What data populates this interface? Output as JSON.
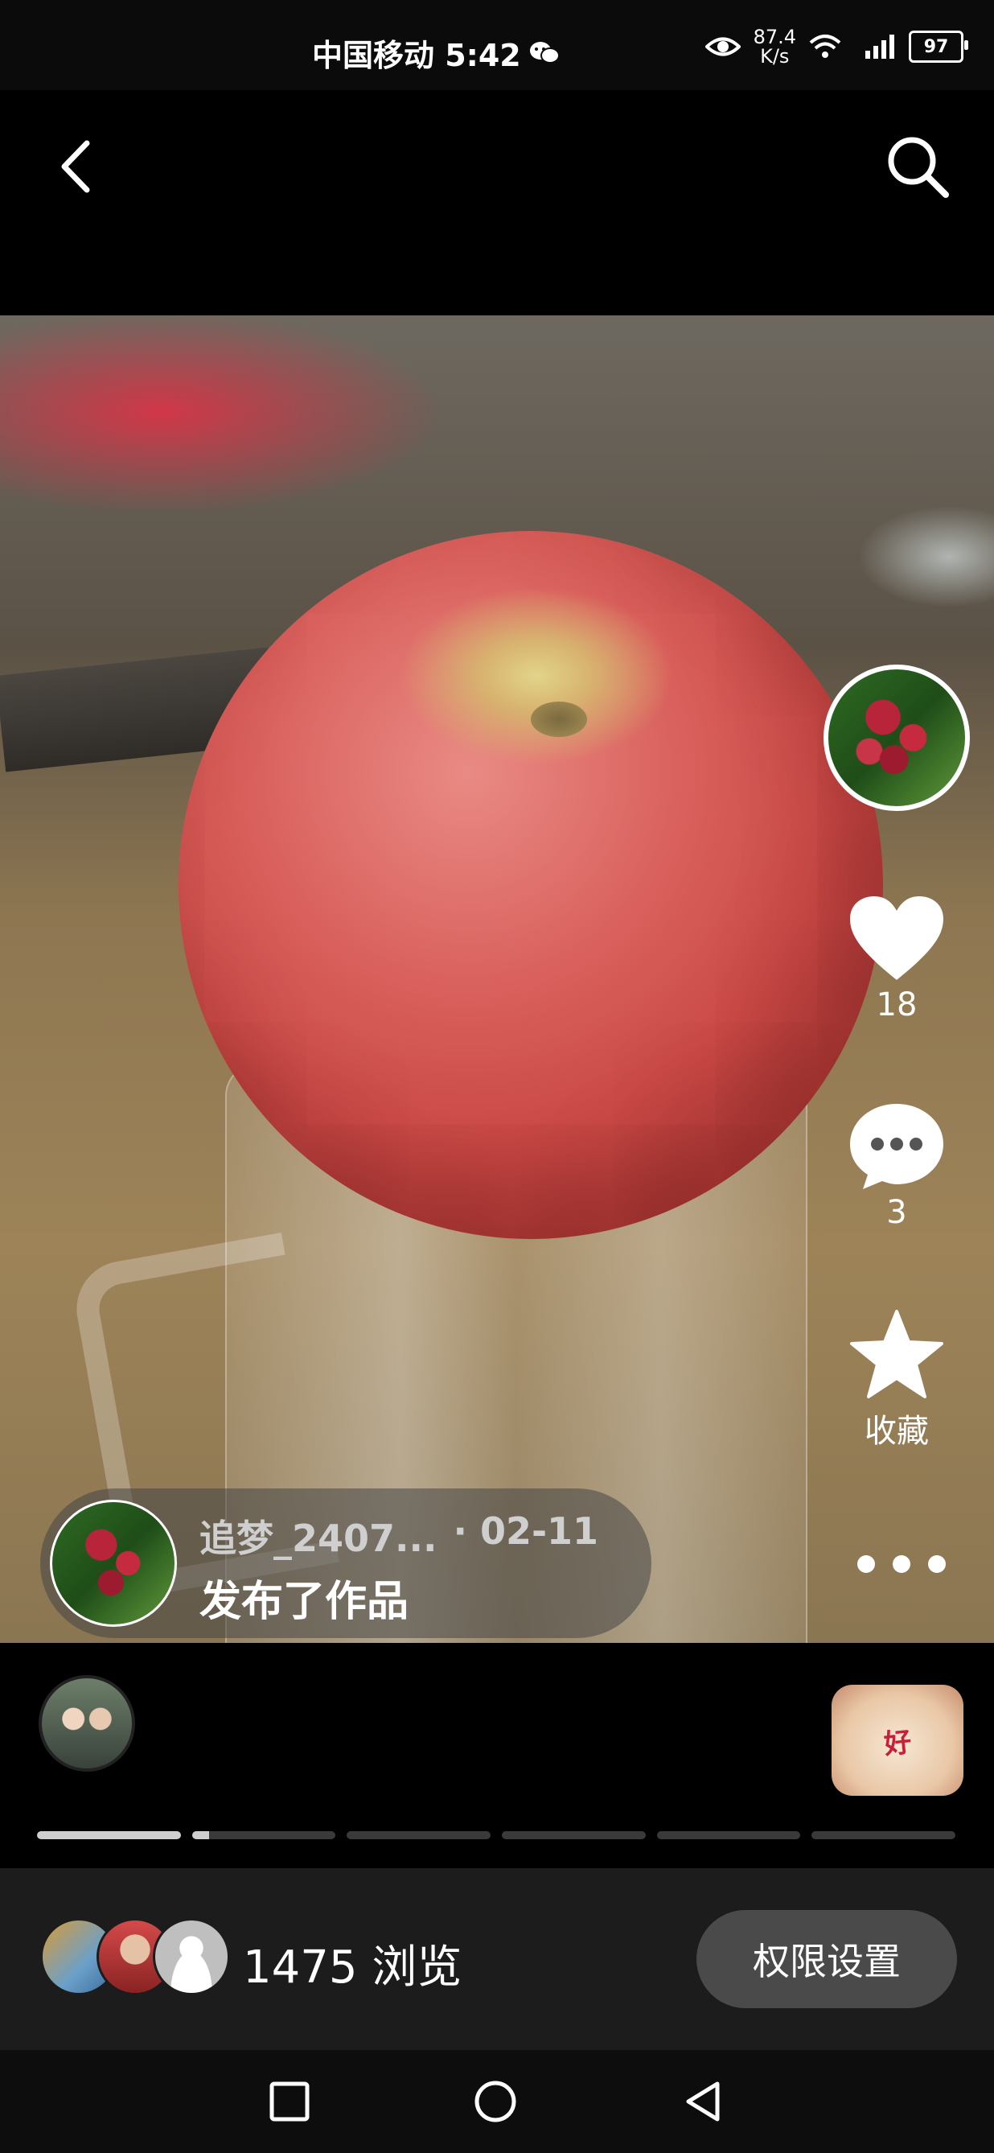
{
  "status_bar": {
    "carrier_time": "中国移动 5:42",
    "net_speed_value": "87.4",
    "net_speed_unit": "K/s",
    "battery": "97",
    "wifi_label": "6",
    "signal_label": "4G"
  },
  "nav": {
    "back_icon": "chevron-left-icon",
    "search_icon": "search-icon"
  },
  "actions": {
    "like_count": "18",
    "comment_count": "3",
    "collect_label": "收藏"
  },
  "post": {
    "author_name": "追梦_2407...",
    "date": "· 02-11",
    "action_text": "发布了作品"
  },
  "thumbnails": {
    "right_text": "好"
  },
  "story_progress": {
    "segments": 6,
    "completed": 1,
    "current_fraction": 0.12
  },
  "footer": {
    "views_text": "1475 浏览",
    "permission_button": "权限设置"
  }
}
